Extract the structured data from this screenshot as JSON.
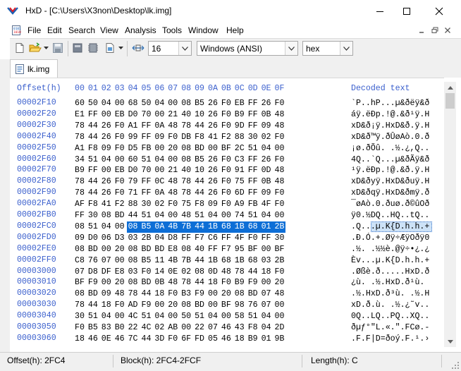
{
  "window": {
    "title": "HxD - [C:\\Users\\X3non\\Desktop\\lk.img]"
  },
  "menu": [
    "File",
    "Edit",
    "Search",
    "View",
    "Analysis",
    "Tools",
    "Window",
    "Help"
  ],
  "toolbar": {
    "bytes_per_row": "16",
    "charset": "Windows (ANSI)",
    "offset_base": "hex"
  },
  "tab": {
    "label": "lk.img"
  },
  "editor": {
    "offset_header": "Offset(h)",
    "column_headers": [
      "00",
      "01",
      "02",
      "03",
      "04",
      "05",
      "06",
      "07",
      "08",
      "09",
      "0A",
      "0B",
      "0C",
      "0D",
      "0E",
      "0F"
    ],
    "decoded_header": "Decoded text",
    "rows": [
      {
        "offset": "00002F10",
        "bytes": [
          "60",
          "50",
          "04",
          "00",
          "68",
          "50",
          "04",
          "00",
          "08",
          "B5",
          "26",
          "F0",
          "EB",
          "FF",
          "26",
          "F0"
        ],
        "text": "`P..hP...µ&ðëÿ&ð"
      },
      {
        "offset": "00002F20",
        "bytes": [
          "E1",
          "FF",
          "00",
          "EB",
          "D0",
          "70",
          "00",
          "21",
          "40",
          "10",
          "26",
          "F0",
          "B9",
          "FF",
          "0B",
          "48"
        ],
        "text": "áÿ.ëÐp.!@.&ð¹ÿ.H"
      },
      {
        "offset": "00002F30",
        "bytes": [
          "78",
          "44",
          "26",
          "F0",
          "A1",
          "FF",
          "0A",
          "48",
          "78",
          "44",
          "26",
          "F0",
          "9D",
          "FF",
          "09",
          "48"
        ],
        "text": "xD&ð¡ÿ.HxD&ð.ÿ.H"
      },
      {
        "offset": "00002F40",
        "bytes": [
          "78",
          "44",
          "26",
          "F0",
          "99",
          "FF",
          "09",
          "F0",
          "DB",
          "F8",
          "41",
          "F2",
          "88",
          "30",
          "02",
          "F0"
        ],
        "text": "xD&ð™ÿ.ðÛøAò.0.ð"
      },
      {
        "offset": "00002F50",
        "bytes": [
          "A1",
          "F8",
          "09",
          "F0",
          "D5",
          "FB",
          "00",
          "20",
          "08",
          "BD",
          "00",
          "BF",
          "2C",
          "51",
          "04",
          "00"
        ],
        "text": "¡ø.ðÕû. .½.¿,Q.."
      },
      {
        "offset": "00002F60",
        "bytes": [
          "34",
          "51",
          "04",
          "00",
          "60",
          "51",
          "04",
          "00",
          "08",
          "B5",
          "26",
          "F0",
          "C3",
          "FF",
          "26",
          "F0"
        ],
        "text": "4Q..`Q...µ&ðÃÿ&ð"
      },
      {
        "offset": "00002F70",
        "bytes": [
          "B9",
          "FF",
          "00",
          "EB",
          "D0",
          "70",
          "00",
          "21",
          "40",
          "10",
          "26",
          "F0",
          "91",
          "FF",
          "0D",
          "48"
        ],
        "text": "¹ÿ.ëÐp.!@.&ð.ÿ.H"
      },
      {
        "offset": "00002F80",
        "bytes": [
          "78",
          "44",
          "26",
          "F0",
          "79",
          "FF",
          "0C",
          "48",
          "78",
          "44",
          "26",
          "F0",
          "75",
          "FF",
          "0B",
          "48"
        ],
        "text": "xD&ðyÿ.HxD&ðuÿ.H"
      },
      {
        "offset": "00002F90",
        "bytes": [
          "78",
          "44",
          "26",
          "F0",
          "71",
          "FF",
          "0A",
          "48",
          "78",
          "44",
          "26",
          "F0",
          "6D",
          "FF",
          "09",
          "F0"
        ],
        "text": "xD&ðqÿ.HxD&ðmÿ.ð"
      },
      {
        "offset": "00002FA0",
        "bytes": [
          "AF",
          "F8",
          "41",
          "F2",
          "88",
          "30",
          "02",
          "F0",
          "75",
          "F8",
          "09",
          "F0",
          "A9",
          "FB",
          "4F",
          "F0"
        ],
        "text": "¯øAò.0.ðuø.ð©ûOð"
      },
      {
        "offset": "00002FB0",
        "bytes": [
          "FF",
          "30",
          "08",
          "BD",
          "44",
          "51",
          "04",
          "00",
          "48",
          "51",
          "04",
          "00",
          "74",
          "51",
          "04",
          "00"
        ],
        "text": "ÿ0.½DQ..HQ..tQ.."
      },
      {
        "offset": "00002FC0",
        "bytes": [
          "08",
          "51",
          "04",
          "00",
          "08",
          "B5",
          "0A",
          "4B",
          "7B",
          "44",
          "1B",
          "68",
          "1B",
          "68",
          "01",
          "2B"
        ],
        "text": ".Q...µ.K{D.h.h.+"
      },
      {
        "offset": "00002FD0",
        "bytes": [
          "09",
          "D0",
          "06",
          "D3",
          "03",
          "2B",
          "04",
          "D8",
          "FF",
          "F7",
          "C6",
          "FF",
          "4F",
          "F0",
          "FF",
          "30"
        ],
        "text": ".Ð.Ó.+.Øÿ÷ÆÿOðÿ0"
      },
      {
        "offset": "00002FE0",
        "bytes": [
          "08",
          "BD",
          "00",
          "20",
          "08",
          "BD",
          "BD",
          "E8",
          "08",
          "40",
          "FF",
          "F7",
          "95",
          "BF",
          "00",
          "BF"
        ],
        "text": ".½. .½½è.@ÿ÷•¿.¿"
      },
      {
        "offset": "00002FF0",
        "bytes": [
          "C8",
          "76",
          "07",
          "00",
          "08",
          "B5",
          "11",
          "4B",
          "7B",
          "44",
          "1B",
          "68",
          "1B",
          "68",
          "03",
          "2B"
        ],
        "text": "Èv...µ.K{D.h.h.+"
      },
      {
        "offset": "00003000",
        "bytes": [
          "07",
          "D8",
          "DF",
          "E8",
          "03",
          "F0",
          "14",
          "0E",
          "02",
          "08",
          "0D",
          "48",
          "78",
          "44",
          "18",
          "F0"
        ],
        "text": ".Øßè.ð.....HxD.ð"
      },
      {
        "offset": "00003010",
        "bytes": [
          "BF",
          "F9",
          "00",
          "20",
          "08",
          "BD",
          "0B",
          "48",
          "78",
          "44",
          "18",
          "F0",
          "B9",
          "F9",
          "00",
          "20"
        ],
        "text": "¿ù. .½.HxD.ð¹ù. "
      },
      {
        "offset": "00003020",
        "bytes": [
          "08",
          "BD",
          "09",
          "48",
          "78",
          "44",
          "18",
          "F0",
          "B3",
          "F9",
          "00",
          "20",
          "08",
          "BD",
          "07",
          "48"
        ],
        "text": ".½.HxD.ð³ù. .½.H"
      },
      {
        "offset": "00003030",
        "bytes": [
          "78",
          "44",
          "18",
          "F0",
          "AD",
          "F9",
          "00",
          "20",
          "08",
          "BD",
          "00",
          "BF",
          "98",
          "76",
          "07",
          "00"
        ],
        "text": "xD.ð.ù. .½.¿˜v.."
      },
      {
        "offset": "00003040",
        "bytes": [
          "30",
          "51",
          "04",
          "00",
          "4C",
          "51",
          "04",
          "00",
          "50",
          "51",
          "04",
          "00",
          "58",
          "51",
          "04",
          "00"
        ],
        "text": "0Q..LQ..PQ..XQ.."
      },
      {
        "offset": "00003050",
        "bytes": [
          "F0",
          "B5",
          "83",
          "B0",
          "22",
          "4C",
          "02",
          "AB",
          "00",
          "22",
          "07",
          "46",
          "43",
          "F8",
          "04",
          "2D"
        ],
        "text": "ðµƒ°\"L.«.\".FCø.-"
      },
      {
        "offset": "00003060",
        "bytes": [
          "18",
          "46",
          "0E",
          "46",
          "7C",
          "44",
          "3D",
          "F0",
          "6F",
          "FD",
          "05",
          "46",
          "18",
          "B9",
          "01",
          "9B"
        ],
        "text": ".F.F|D=ðoý.F.¹.›"
      }
    ]
  },
  "status": {
    "offset": "Offset(h): 2FC4",
    "block": "Block(h): 2FC4-2FCF",
    "length": "Length(h): C"
  }
}
